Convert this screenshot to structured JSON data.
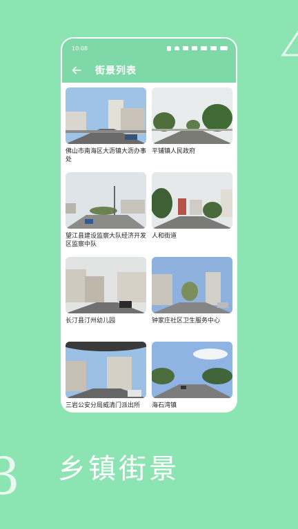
{
  "status": {
    "time": "10:08"
  },
  "appbar": {
    "title": "街景列表"
  },
  "items": [
    {
      "label": "佛山市南海区大沥镇大沥办事处"
    },
    {
      "label": "平铺镇人民政府"
    },
    {
      "label": "望江县建设监察大队经济开发区监察中队"
    },
    {
      "label": "人和街道"
    },
    {
      "label": "长汀县汀州幼儿园"
    },
    {
      "label": "钟家庄社区卫生服务中心"
    },
    {
      "label": "三岩公安分局威清门派出所"
    },
    {
      "label": "海石湾镇"
    }
  ],
  "slogan": "乡镇街景",
  "decor": {
    "left_char": "3"
  },
  "colors": {
    "background": "#8ce4b3",
    "appbar": "#7ed8a8"
  }
}
